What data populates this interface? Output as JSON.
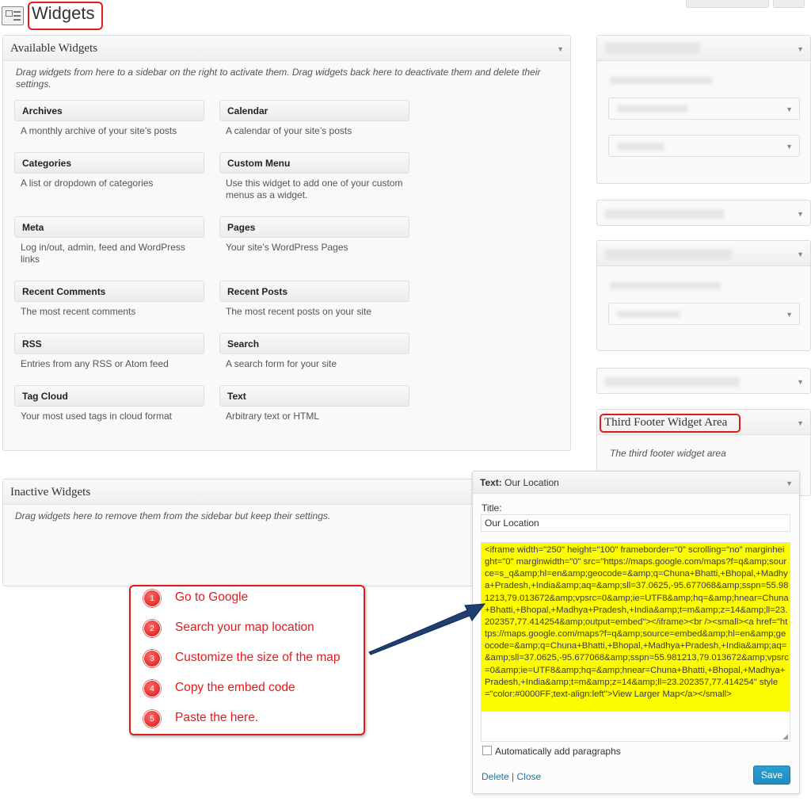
{
  "header": {
    "title": "Widgets"
  },
  "available": {
    "title": "Available Widgets",
    "description": "Drag widgets from here to a sidebar on the right to activate them. Drag widgets back here to deactivate them and delete their settings.",
    "widgets": [
      {
        "name": "Archives",
        "desc": "A monthly archive of your site’s posts"
      },
      {
        "name": "Calendar",
        "desc": "A calendar of your site’s posts"
      },
      {
        "name": "Categories",
        "desc": "A list or dropdown of categories"
      },
      {
        "name": "Custom Menu",
        "desc": "Use this widget to add one of your custom menus as a widget."
      },
      {
        "name": "Meta",
        "desc": "Log in/out, admin, feed and WordPress links"
      },
      {
        "name": "Pages",
        "desc": "Your site’s WordPress Pages"
      },
      {
        "name": "Recent Comments",
        "desc": "The most recent comments"
      },
      {
        "name": "Recent Posts",
        "desc": "The most recent posts on your site"
      },
      {
        "name": "RSS",
        "desc": "Entries from any RSS or Atom feed"
      },
      {
        "name": "Search",
        "desc": "A search form for your site"
      },
      {
        "name": "Tag Cloud",
        "desc": "Your most used tags in cloud format"
      },
      {
        "name": "Text",
        "desc": "Arbitrary text or HTML"
      }
    ]
  },
  "inactive": {
    "title": "Inactive Widgets",
    "description": "Drag widgets here to remove them from the sidebar but keep their settings."
  },
  "sidebar": {
    "third_footer": {
      "title": "Third Footer Widget Area",
      "description": "The third footer widget area"
    }
  },
  "text_widget": {
    "header_prefix": "Text:",
    "header_name": "Our Location",
    "title_label": "Title:",
    "title_value": "Our Location",
    "code": "<iframe width=\"250\" height=\"100\" frameborder=\"0\" scrolling=\"no\" marginheight=\"0\" marginwidth=\"0\" src=\"https://maps.google.com/maps?f=q&amp;source=s_q&amp;hl=en&amp;geocode=&amp;q=Chuna+Bhatti,+Bhopal,+Madhya+Pradesh,+India&amp;aq=&amp;sll=37.0625,-95.677068&amp;sspn=55.981213,79.013672&amp;vpsrc=0&amp;ie=UTF8&amp;hq=&amp;hnear=Chuna+Bhatti,+Bhopal,+Madhya+Pradesh,+India&amp;t=m&amp;z=14&amp;ll=23.202357,77.414254&amp;output=embed\"></iframe><br /><small><a href=\"https://maps.google.com/maps?f=q&amp;source=embed&amp;hl=en&amp;geocode=&amp;q=Chuna+Bhatti,+Bhopal,+Madhya+Pradesh,+India&amp;aq=&amp;sll=37.0625,-95.677068&amp;sspn=55.981213,79.013672&amp;vpsrc=0&amp;ie=UTF8&amp;hq=&amp;hnear=Chuna+Bhatti,+Bhopal,+Madhya+Pradesh,+India&amp;t=m&amp;z=14&amp;ll=23.202357,77.414254\" style=\"color:#0000FF;text-align:left\">View Larger Map</a></small>",
    "auto_paragraphs_label": "Automatically add paragraphs",
    "delete_label": "Delete",
    "separator": "|",
    "close_label": "Close",
    "save_label": "Save"
  },
  "steps": [
    {
      "num": "1",
      "text": "Go to Google"
    },
    {
      "num": "2",
      "text": "Search your map location"
    },
    {
      "num": "3",
      "text": "Customize the size of the map"
    },
    {
      "num": "4",
      "text": "Copy the embed code"
    },
    {
      "num": "5",
      "text": "Paste the here."
    }
  ],
  "colors": {
    "annotation_red": "#e01b1b",
    "code_highlight": "#fdfb00",
    "arrow_blue": "#1f3f73",
    "link_blue": "#21759b",
    "save_blue": "#1e8cbe"
  }
}
